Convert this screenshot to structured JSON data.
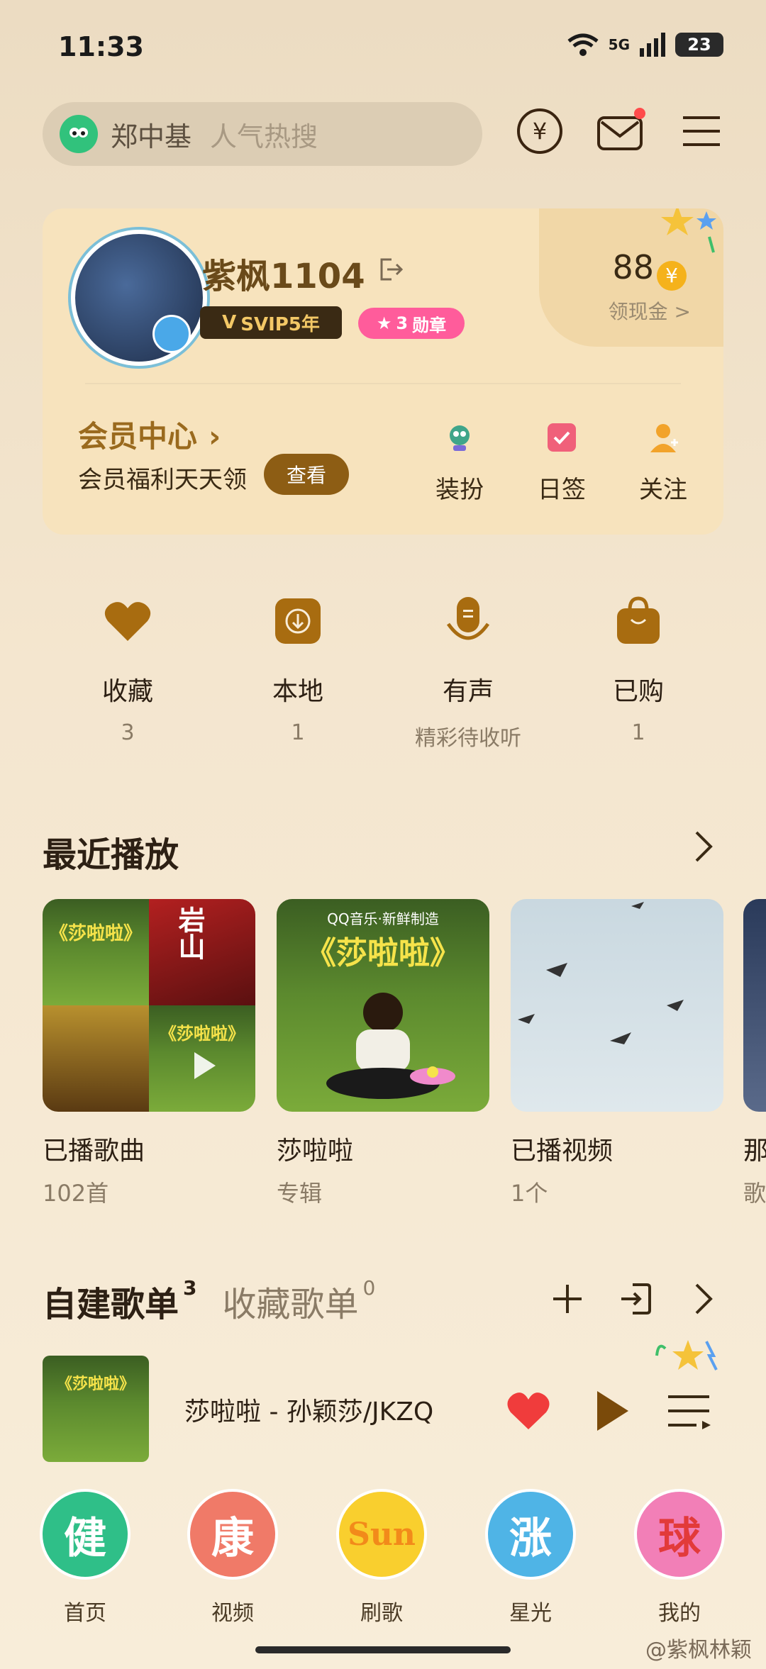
{
  "status": {
    "time": "11:33",
    "network": "5G",
    "battery": "23"
  },
  "search": {
    "term": "郑中基",
    "placeholder": "人气热搜"
  },
  "profile": {
    "username": "紫枫1104",
    "svip": "SVIP5年",
    "medal_count": "3",
    "medal_label": "勋章",
    "coins": "88",
    "coins_link": "领现金 >"
  },
  "vip_center": {
    "title": "会员中心",
    "subtitle": "会员福利天天领",
    "button": "查看",
    "actions": [
      "装扮",
      "日签",
      "关注"
    ]
  },
  "quick_entries": [
    {
      "label": "收藏",
      "sub": "3",
      "icon": "heart-icon"
    },
    {
      "label": "本地",
      "sub": "1",
      "icon": "download-icon"
    },
    {
      "label": "有声",
      "sub": "精彩待收听",
      "icon": "audio-icon"
    },
    {
      "label": "已购",
      "sub": "1",
      "icon": "shopping-bag-icon"
    }
  ],
  "recent": {
    "title": "最近播放",
    "items": [
      {
        "title": "已播歌曲",
        "sub": "102首"
      },
      {
        "title": "莎啦啦",
        "sub": "专辑"
      },
      {
        "title": "已播视频",
        "sub": "1个"
      },
      {
        "title": "那",
        "sub": "歌"
      }
    ],
    "art_text": "《莎啦啦》",
    "art_brand": "QQ音乐·新鲜制造",
    "art_side": "岩山"
  },
  "playlists": {
    "tab_created": "自建歌单",
    "tab_created_count": "3",
    "tab_collected": "收藏歌单",
    "tab_collected_count": "0"
  },
  "now_playing": {
    "title": "莎啦啦 - 孙颖莎/JKZQ"
  },
  "tabbar": {
    "items": [
      {
        "glyph": "健",
        "label": "首页",
        "color": "#2fbf88"
      },
      {
        "glyph": "康",
        "label": "视频",
        "color": "#f07a68"
      },
      {
        "glyph": "Sun",
        "label": "刷歌",
        "color": "#f9cf2e"
      },
      {
        "glyph": "涨",
        "label": "星光",
        "color": "#4fb4e6"
      },
      {
        "glyph": "球",
        "label": "我的",
        "color": "#f27fb7"
      }
    ]
  },
  "watermark": "@紫枫林颖"
}
